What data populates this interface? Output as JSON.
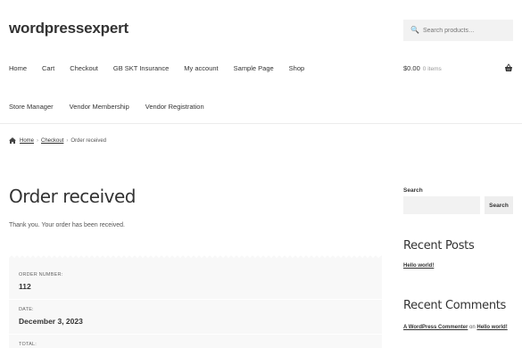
{
  "site": {
    "title": "wordpressexpert"
  },
  "search": {
    "placeholder": "Search products…"
  },
  "nav": {
    "primary": [
      "Home",
      "Cart",
      "Checkout",
      "GB SKT Insurance",
      "My account",
      "Sample Page",
      "Shop"
    ],
    "secondary": [
      "Store Manager",
      "Vendor Membership",
      "Vendor Registration"
    ]
  },
  "cart": {
    "amount": "$0.00",
    "count_label": "0 items"
  },
  "breadcrumb": {
    "home": "Home",
    "checkout": "Checkout",
    "current": "Order received",
    "separator": "›"
  },
  "page": {
    "title": "Order received",
    "message": "Thank you. Your order has been received."
  },
  "order": {
    "number_label": "ORDER NUMBER:",
    "number": "112",
    "date_label": "DATE:",
    "date": "December 3, 2023",
    "total_label": "TOTAL:"
  },
  "sidebar": {
    "search_label": "Search",
    "search_button": "Search",
    "recent_posts_title": "Recent Posts",
    "recent_posts": [
      "Hello world!"
    ],
    "recent_comments_title": "Recent Comments",
    "comment_author": "A WordPress Commenter",
    "comment_on": "on",
    "comment_post": "Hello world!"
  },
  "icons": {
    "search": "search-icon",
    "basket": "basket-icon",
    "home": "home-icon"
  }
}
